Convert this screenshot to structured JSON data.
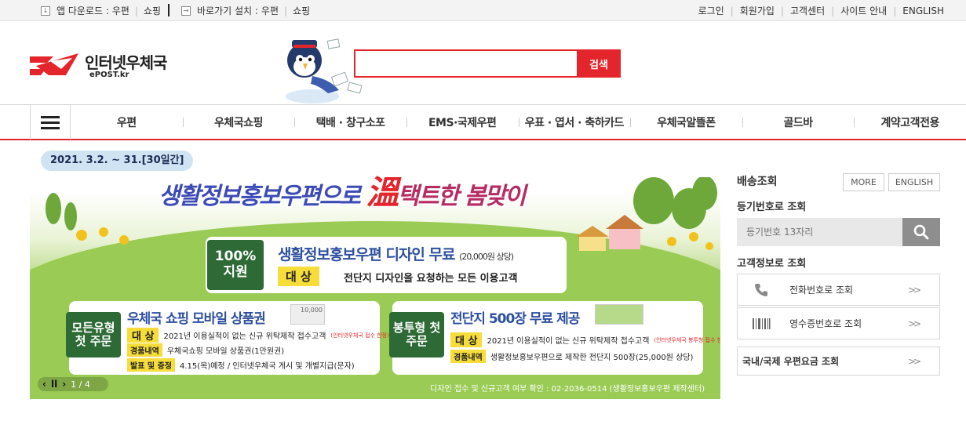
{
  "util": {
    "app_label": "앱 다운로드 :",
    "app_links": [
      "우편",
      "쇼핑"
    ],
    "shortcut_label": "바로가기 설치 :",
    "shortcut_links": [
      "우편",
      "쇼핑"
    ],
    "right_links": [
      "로그인",
      "회원가입",
      "고객센터",
      "사이트 안내",
      "ENGLISH"
    ]
  },
  "header": {
    "logo_name": "인터넷우체국",
    "logo_sub": "ePOST.kr",
    "search_button": "검색",
    "search_value": ""
  },
  "gnb": {
    "items": [
      "우편",
      "우체국쇼핑",
      "택배 · 창구소포",
      "EMS·국제우편",
      "우표 · 엽서 · 축하카드",
      "우체국알뜰폰",
      "골드바",
      "계약고객전용"
    ]
  },
  "banner": {
    "date": "2021. 3.2. ~ 31.[30일간]",
    "headline_a": "생활정보홍보우편으로",
    "headline_b": "溫",
    "headline_c": "택트한 봄맞이",
    "main_tag": "100% 지원",
    "main_title": "생활정보홍보우편 디자인 무료",
    "main_title_note": "(20,000원 상당)",
    "main_target_label": "대 상",
    "main_target": "전단지 디자인을 요청하는 모든 이용고객",
    "left_tag": "모든유형 첫 주문",
    "left_title": "우체국 쇼핑 모바일 상품권",
    "left_thumb": "10,000",
    "left_row1_label": "대 상",
    "left_row1": "2021년 이용실적이 없는 신규 위탁제작 접수고객",
    "left_row1_note": "(인터넷우체국 접수 한정)",
    "left_row2_label": "경품내역",
    "left_row2": "우체국쇼핑 모바일 상품권(1만원권)",
    "left_row3_label": "발표 및 증정",
    "left_row3": "4.15(목)예정 / 인터넷우체국 게시 및 개별지급(문자)",
    "right_tag": "봉투형 첫 주문",
    "right_title": "전단지 500장 무료 제공",
    "right_row1_label": "대 상",
    "right_row1": "2021년 이용실적이 없는 신규 위탁제작 접수고객",
    "right_row1_note": "(인터넷우체국 봉투형 접수 한정)",
    "right_row2_label": "경품내역",
    "right_row2": "생활정보홍보우편으로 제작한 전단지 500장(25,000원 상당)",
    "pager": "1 / 4",
    "footer": "디자인 접수 및 신규고객 여부 확인 : 02-2036-0514 (생활정보홍보우편 제작센터)"
  },
  "side": {
    "title": "배송조회",
    "more": "MORE",
    "english": "ENGLISH",
    "reg_label": "등기번호로 조회",
    "reg_placeholder": "등기번호 13자리",
    "cust_label": "고객정보로 조회",
    "phone_item": "전화번호로 조회",
    "receipt_item": "영수증번호로 조회",
    "rate_item": "국내/국제 우편요금 조회"
  },
  "colors": {
    "accent": "#e4262c",
    "nav_text": "#333333"
  }
}
